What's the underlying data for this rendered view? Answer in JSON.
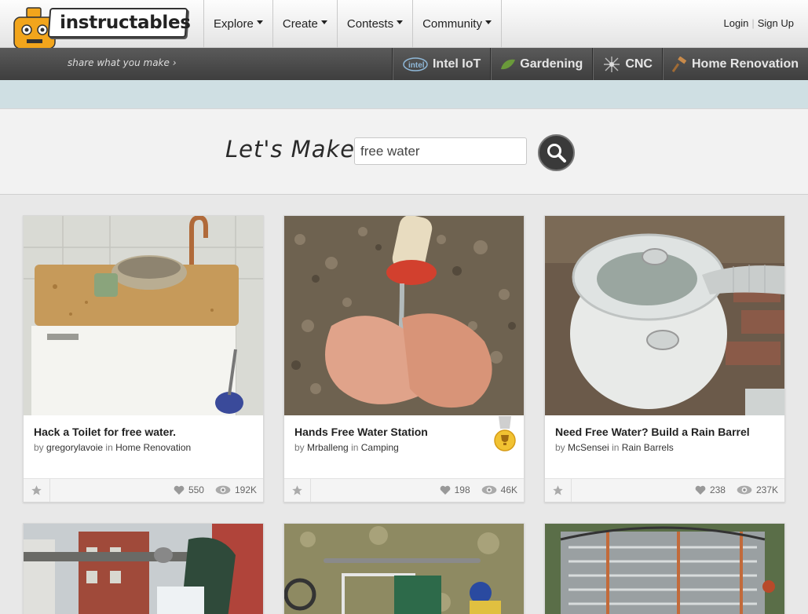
{
  "header": {
    "logo_text": "instructables",
    "tagline": "share what you make",
    "nav": [
      {
        "label": "Explore"
      },
      {
        "label": "Create"
      },
      {
        "label": "Contests"
      },
      {
        "label": "Community"
      }
    ],
    "login": "Login",
    "signup": "Sign Up",
    "channels": [
      {
        "label": "Intel IoT",
        "icon": "intel-icon"
      },
      {
        "label": "Gardening",
        "icon": "leaf-icon"
      },
      {
        "label": "CNC",
        "icon": "cnc-burst-icon"
      },
      {
        "label": "Home Renovation",
        "icon": "hammer-icon"
      }
    ]
  },
  "search": {
    "heading": "Let's Make",
    "value": "free water"
  },
  "cards": [
    {
      "title": "Hack a Toilet for free water.",
      "by": "by",
      "author": "gregorylavoie",
      "in": "in",
      "category": "Home Renovation",
      "likes": "550",
      "views": "192K",
      "medal": false
    },
    {
      "title": "Hands Free Water Station",
      "by": "by",
      "author": "Mrballeng",
      "in": "in",
      "category": "Camping",
      "likes": "198",
      "views": "46K",
      "medal": true
    },
    {
      "title": "Need Free Water? Build a Rain Barrel",
      "by": "by",
      "author": "McSensei",
      "in": "in",
      "category": "Rain Barrels",
      "likes": "238",
      "views": "237K",
      "medal": false
    }
  ],
  "colors": {
    "subbar": "#4a4a4a",
    "band": "#cfdfe3",
    "robot": "#f2a51c"
  }
}
